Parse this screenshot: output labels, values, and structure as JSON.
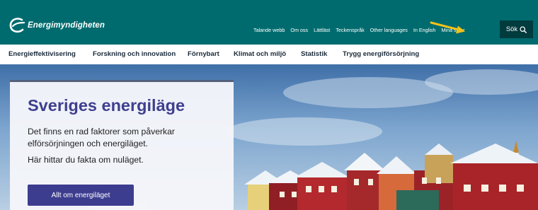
{
  "brand": {
    "name": "Energimyndigheten",
    "color": "#006b6e",
    "logo_icon": "energimyndigheten-logo-icon"
  },
  "toplinks": [
    "Talande webb",
    "Om oss",
    "Lättläst",
    "Teckenspråk",
    "Other languages",
    "In English",
    "Mina sidor"
  ],
  "search": {
    "label": "Sök",
    "icon": "search-icon"
  },
  "mainnav": [
    "Energieffektivisering",
    "Forskning och innovation",
    "Förnybart",
    "Klimat och miljö",
    "Statistik",
    "Trygg energiförsörjning"
  ],
  "hero": {
    "title": "Sveriges energiläge",
    "text1": "Det finns en rad faktorer som påverkar elförsörjningen och energiläget.",
    "text2": "Här hittar du fakta om nuläget.",
    "cta": "Allt om energiläget"
  },
  "annotation": {
    "icon": "arrow-icon",
    "color": "#f2c21b"
  }
}
